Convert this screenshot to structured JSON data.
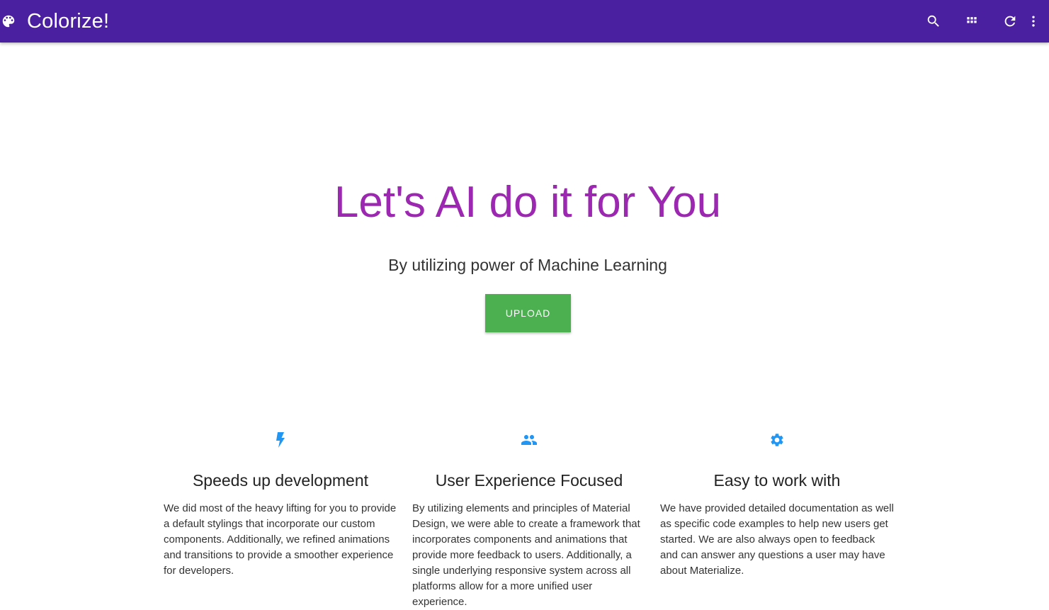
{
  "navbar": {
    "brand_icon": "palette-icon",
    "title": "Colorize!",
    "actions": [
      {
        "name": "search-icon"
      },
      {
        "name": "apps-grid-icon"
      },
      {
        "name": "refresh-icon"
      },
      {
        "name": "more-vert-icon"
      }
    ],
    "color": "#4a20a0"
  },
  "hero": {
    "title": "Let's AI do it for You",
    "title_color": "#9c27b0",
    "subtitle": "By utilizing power of Machine Learning",
    "upload_label": "UPLOAD",
    "upload_color": "#4caf50"
  },
  "features": [
    {
      "icon": "flash-icon",
      "title": "Speeds up development",
      "text": "We did most of the heavy lifting for you to provide a default stylings that incorporate our custom components. Additionally, we refined animations and transitions to provide a smoother experience for developers."
    },
    {
      "icon": "group-icon",
      "title": "User Experience Focused",
      "text": "By utilizing elements and principles of Material Design, we were able to create a framework that incorporates components and animations that provide more feedback to users. Additionally, a single underlying responsive system across all platforms allow for a more unified user experience."
    },
    {
      "icon": "settings-icon",
      "title": "Easy to work with",
      "text": "We have provided detailed documentation as well as specific code examples to help new users get started. We are also always open to feedback and can answer any questions a user may have about Materialize."
    }
  ],
  "accent_icon_color": "#2196f3"
}
